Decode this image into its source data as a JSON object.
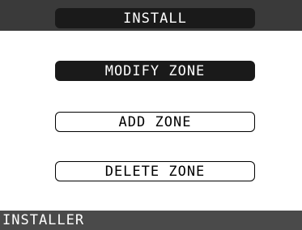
{
  "header": {
    "title": "INSTALL"
  },
  "menu": {
    "items": [
      {
        "label": "MODIFY ZONE",
        "selected": true
      },
      {
        "label": "ADD ZONE",
        "selected": false
      },
      {
        "label": "DELETE ZONE",
        "selected": false
      }
    ]
  },
  "footer": {
    "label": "INSTALLER"
  },
  "colors": {
    "header_bar": "#3a3a3a",
    "pill_dark": "#1a1a1a",
    "footer_bar": "#4a4a4a",
    "background": "#ffffff"
  }
}
